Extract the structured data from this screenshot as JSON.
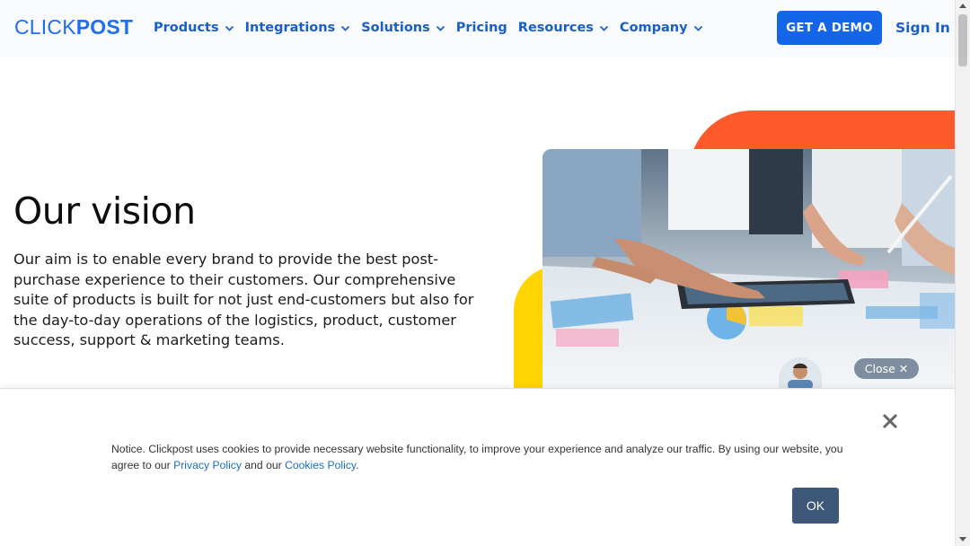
{
  "brand": {
    "logo_part1": "CLICK",
    "logo_part2": "POST"
  },
  "nav": {
    "items": [
      {
        "label": "Products",
        "has_dropdown": true
      },
      {
        "label": "Integrations",
        "has_dropdown": true
      },
      {
        "label": "Solutions",
        "has_dropdown": true
      },
      {
        "label": "Pricing",
        "has_dropdown": false
      },
      {
        "label": "Resources",
        "has_dropdown": true
      },
      {
        "label": "Company",
        "has_dropdown": true
      }
    ],
    "cta_label": "GET A DEMO",
    "signin_label": "Sign In"
  },
  "hero": {
    "title": "Our vision",
    "body": "Our aim is to enable every brand to provide the best post-purchase experience to their customers. Our comprehensive suite of products is built for not just end-customers but also for the day-to-day operations of the logistics, product, customer success, support & marketing teams."
  },
  "chat_widget": {
    "close_label": "Close ✕"
  },
  "cookie_banner": {
    "text_before": "Notice. Clickpost uses cookies to provide necessary website functionality, to improve your experience and analyze our traffic. By using our website, you agree to our ",
    "privacy_link": "Privacy Policy",
    "text_middle": " and our ",
    "cookies_link": "Cookies Policy",
    "text_after": ".",
    "ok_label": "OK"
  },
  "colors": {
    "brand_blue": "#1565e8",
    "nav_blue": "#1a5fc6",
    "accent_orange": "#ff5a2b",
    "accent_yellow": "#ffd400",
    "ok_button": "#3d5878"
  },
  "icons": {
    "nav_dropdown": "chevron-down-icon",
    "cookie_close": "close-icon"
  }
}
